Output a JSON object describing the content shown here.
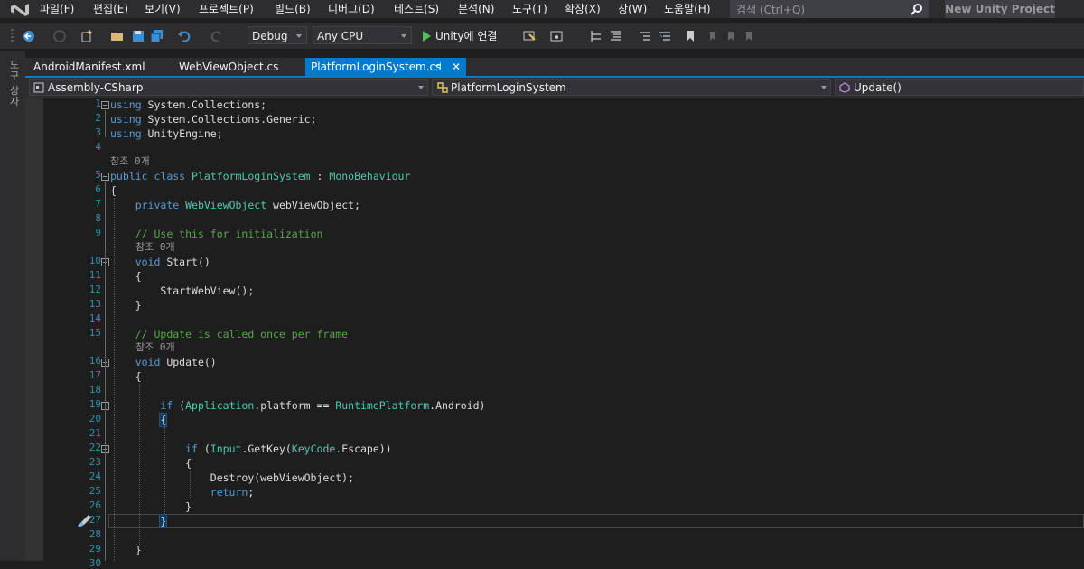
{
  "menubar": {
    "items": [
      "파일(F)",
      "편집(E)",
      "보기(V)",
      "프로젝트(P)",
      "빌드(B)",
      "디버그(D)",
      "테스트(S)",
      "분석(N)",
      "도구(T)",
      "확장(X)",
      "창(W)",
      "도움말(H)"
    ],
    "search_placeholder": "검색 (Ctrl+Q)",
    "project_name": "New Unity Project"
  },
  "toolbar": {
    "config": "Debug",
    "platform": "Any CPU",
    "play_label": "Unity에 연결"
  },
  "sidebar": {
    "label": "도구 상자"
  },
  "tabs": [
    {
      "label": "AndroidManifest.xml"
    },
    {
      "label": "WebViewObject.cs"
    },
    {
      "label": "PlatformLoginSystem.cs",
      "pin": "⊣",
      "close": "✕"
    }
  ],
  "navbar": {
    "project": "Assembly-CSharp",
    "class": "PlatformLoginSystem",
    "member": "Update()"
  },
  "code": {
    "lens": "참조 0개",
    "lines": [
      "using System.Collections;",
      "using System.Collections.Generic;",
      "using UnityEngine;",
      "",
      "public class PlatformLoginSystem : MonoBehaviour",
      "{",
      "    private WebViewObject webViewObject;",
      "",
      "    // Use this for initialization",
      "    void Start()",
      "    {",
      "        StartWebView();",
      "    }",
      "",
      "    // Update is called once per frame",
      "    void Update()",
      "    {",
      "",
      "        if (Application.platform == RuntimePlatform.Android)",
      "        {",
      "",
      "            if (Input.GetKey(KeyCode.Escape))",
      "            {",
      "                Destroy(webViewObject);",
      "                return;",
      "            }",
      "        }",
      "",
      "    }"
    ],
    "line_numbers": [
      "1",
      "2",
      "3",
      "4",
      "5",
      "6",
      "7",
      "8",
      "9",
      "10",
      "11",
      "12",
      "13",
      "14",
      "15",
      "16",
      "17",
      "18",
      "19",
      "20",
      "21",
      "22",
      "23",
      "24",
      "25",
      "26",
      "27",
      "28",
      "29",
      "30"
    ]
  }
}
